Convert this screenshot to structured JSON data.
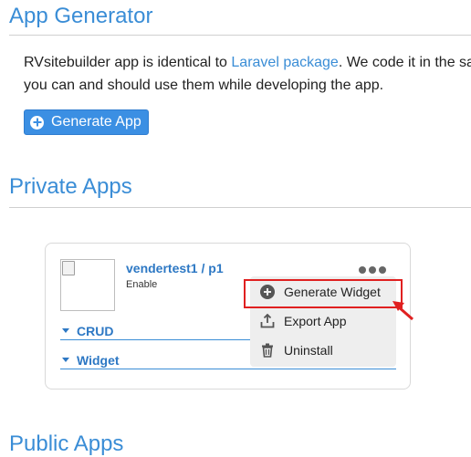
{
  "app_generator": {
    "title": "App Generator",
    "intro_before_link": "RVsitebuilder app is identical to ",
    "intro_link": "Laravel package",
    "intro_after_link": ". We code it in the sa",
    "intro_line2": "you can and should use them while developing the app.",
    "generate_button": "Generate App"
  },
  "private_apps": {
    "title": "Private Apps",
    "app": {
      "name": "vendertest1 / p1",
      "status": "Enable",
      "accordion": [
        "CRUD",
        "Widget"
      ]
    },
    "menu": {
      "items": [
        {
          "label": "Generate Widget",
          "icon": "plus-circle-icon"
        },
        {
          "label": "Export App",
          "icon": "export-icon"
        },
        {
          "label": "Uninstall",
          "icon": "trash-icon"
        }
      ],
      "highlight_color": "#e02020"
    }
  },
  "public_apps": {
    "title": "Public Apps"
  },
  "colors": {
    "accent": "#3a8dd6",
    "button": "#3b8fe3"
  }
}
